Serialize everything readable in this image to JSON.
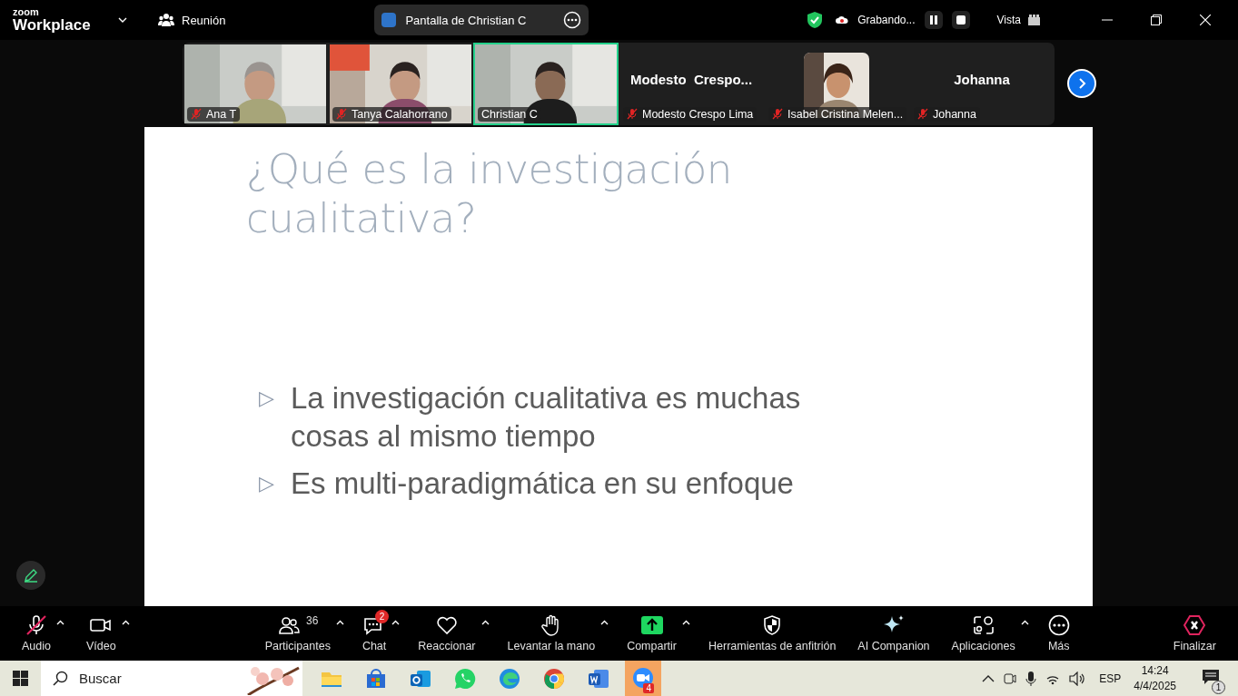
{
  "title_bar": {
    "brand_small": "zoom",
    "brand": "Workplace",
    "meeting_label": "Reunión",
    "share_title": "Pantalla de Christian C",
    "recording": "Grabando...",
    "view": "Vista"
  },
  "participants": [
    {
      "name": "Ana T",
      "kind": "video",
      "muted": true,
      "active": false
    },
    {
      "name": "Tanya Calahorrano",
      "kind": "video",
      "muted": true,
      "active": false
    },
    {
      "name": "Christian C",
      "kind": "video",
      "muted": false,
      "active": true
    },
    {
      "name": "Modesto Crespo Lima",
      "display": "Modesto  Crespo...",
      "kind": "name",
      "muted": true,
      "active": false
    },
    {
      "name": "Isabel Cristina Melen...",
      "muted": true,
      "active": false
    },
    {
      "name": "Johanna",
      "display": "Johanna",
      "kind": "name",
      "muted": true,
      "active": false
    }
  ],
  "slide": {
    "title": "¿Qué es la investigación cualitativa?",
    "marker": "▷",
    "bullets": [
      "La investigación cualitativa es muchas cosas al mismo tiempo",
      "Es multi-paradigmática en su enfoque"
    ]
  },
  "toolbar": [
    {
      "label": "Audio",
      "kind": "mic",
      "muted": true,
      "caret": true
    },
    {
      "label": "Vídeo",
      "kind": "camera",
      "caret": true
    },
    {
      "label": "Participantes",
      "kind": "people",
      "count": "36",
      "caret": true
    },
    {
      "label": "Chat",
      "kind": "chat",
      "badge": "2",
      "caret": true
    },
    {
      "label": "Reaccionar",
      "kind": "heart",
      "caret": true
    },
    {
      "label": "Levantar la mano",
      "kind": "hand",
      "caret": true
    },
    {
      "label": "Compartir",
      "kind": "share",
      "caret": true
    },
    {
      "label": "Herramientas de anfitrión",
      "kind": "shield",
      "caret": false
    },
    {
      "label": "AI Companion",
      "kind": "sparkle",
      "caret": false
    },
    {
      "label": "Aplicaciones",
      "kind": "apps",
      "caret": true
    },
    {
      "label": "Más",
      "kind": "more",
      "caret": false
    },
    {
      "label": "Finalizar",
      "kind": "end",
      "caret": false
    }
  ],
  "taskbar": {
    "search_placeholder": "Buscar",
    "apps": [
      {
        "kind": "folder",
        "selected": false
      },
      {
        "kind": "store",
        "selected": false
      },
      {
        "kind": "outlook",
        "selected": false
      },
      {
        "kind": "whatsapp",
        "selected": false
      },
      {
        "kind": "edge",
        "selected": false
      },
      {
        "kind": "chrome",
        "selected": false
      },
      {
        "kind": "word",
        "selected": false
      },
      {
        "kind": "zoom",
        "selected": true,
        "badge": "4"
      }
    ],
    "language": "ESP",
    "time": "14:24",
    "date": "4/4/2025",
    "notifications": "1"
  }
}
